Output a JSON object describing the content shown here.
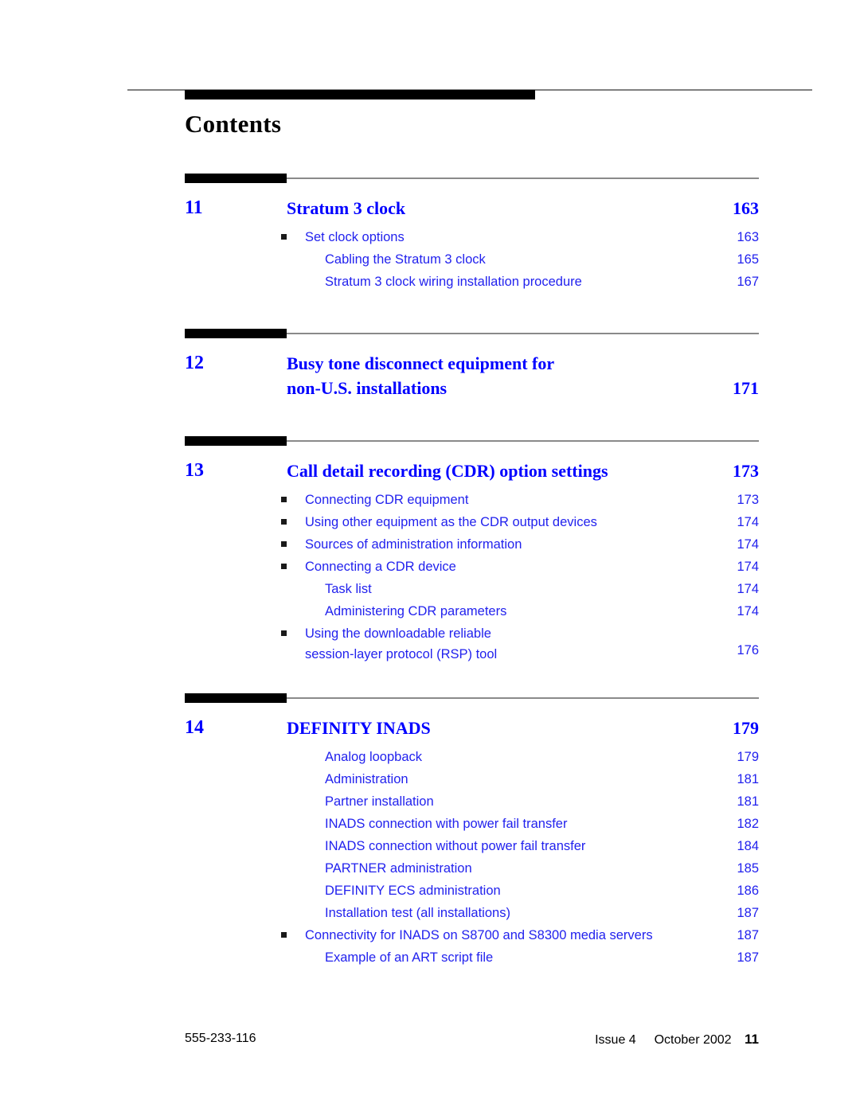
{
  "document": {
    "title": "Contents"
  },
  "chapters": [
    {
      "number": "11",
      "title": "Stratum 3 clock",
      "page": "163",
      "entries": [
        {
          "level": 1,
          "bullet": true,
          "label": "Set clock options",
          "page": "163"
        },
        {
          "level": 2,
          "bullet": false,
          "label": "Cabling the Stratum 3 clock",
          "page": "165"
        },
        {
          "level": 2,
          "bullet": false,
          "label": "Stratum 3 clock wiring installation procedure",
          "page": "167"
        }
      ]
    },
    {
      "number": "12",
      "title": "Busy tone disconnect equipment for\n non-U.S. installations",
      "page": "171",
      "entries": []
    },
    {
      "number": "13",
      "title": "Call detail recording (CDR) option settings",
      "page": "173",
      "entries": [
        {
          "level": 1,
          "bullet": true,
          "label": "Connecting CDR equipment",
          "page": "173"
        },
        {
          "level": 1,
          "bullet": true,
          "label": "Using other equipment as the CDR output devices",
          "page": "174"
        },
        {
          "level": 1,
          "bullet": true,
          "label": "Sources of administration information",
          "page": "174"
        },
        {
          "level": 1,
          "bullet": true,
          "label": "Connecting a CDR device",
          "page": "174"
        },
        {
          "level": 2,
          "bullet": false,
          "label": "Task list",
          "page": "174"
        },
        {
          "level": 2,
          "bullet": false,
          "label": "Administering CDR parameters",
          "page": "174"
        },
        {
          "level": 1,
          "bullet": true,
          "label": "Using the downloadable reliable\n session-layer protocol (RSP) tool",
          "page": "176",
          "twoLine": true
        }
      ]
    },
    {
      "number": "14",
      "title": "DEFINITY INADS",
      "page": "179",
      "entries": [
        {
          "level": 2,
          "bullet": false,
          "label": "Analog loopback",
          "page": "179"
        },
        {
          "level": 2,
          "bullet": false,
          "label": "Administration",
          "page": "181"
        },
        {
          "level": 2,
          "bullet": false,
          "label": "Partner installation",
          "page": "181"
        },
        {
          "level": 2,
          "bullet": false,
          "label": "INADS connection with power fail transfer",
          "page": "182"
        },
        {
          "level": 2,
          "bullet": false,
          "label": "INADS connection without power fail transfer",
          "page": "184"
        },
        {
          "level": 2,
          "bullet": false,
          "label": "PARTNER administration",
          "page": "185"
        },
        {
          "level": 2,
          "bullet": false,
          "label": "DEFINITY ECS administration",
          "page": "186"
        },
        {
          "level": 2,
          "bullet": false,
          "label": "Installation test (all installations)",
          "page": "187"
        },
        {
          "level": 1,
          "bullet": true,
          "label": "Connectivity for INADS on S8700 and S8300 media servers",
          "page": "187"
        },
        {
          "level": 2,
          "bullet": false,
          "label": "Example of an ART script file",
          "page": "187"
        }
      ]
    }
  ],
  "footer": {
    "document_number": "555-233-116",
    "issue": "Issue 4",
    "date": "October 2002",
    "folio": "11"
  },
  "layout": {
    "chapter_tops": [
      218,
      413,
      548,
      871
    ]
  },
  "colors": {
    "link_blue": "#0000ff",
    "entry_blue": "#2222ee",
    "rule_gray": "#808080",
    "bar_black": "#000000"
  }
}
